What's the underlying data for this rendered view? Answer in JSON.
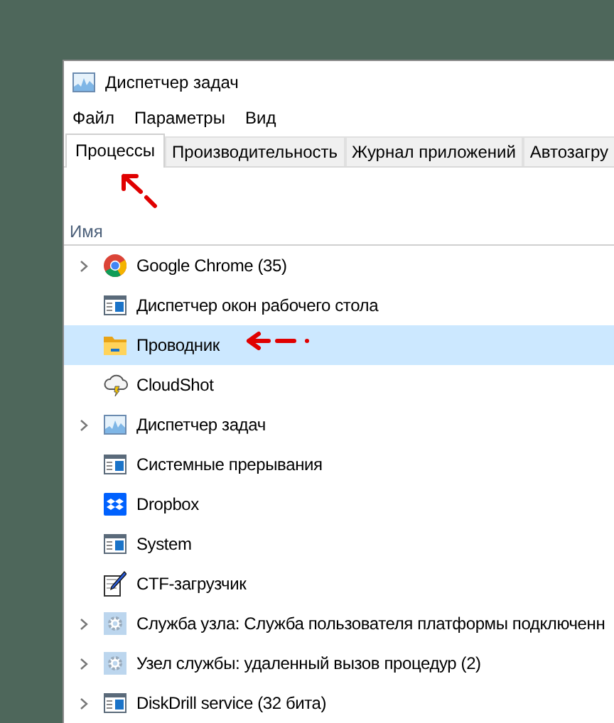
{
  "window": {
    "title": "Диспетчер задач"
  },
  "menu": [
    "Файл",
    "Параметры",
    "Вид"
  ],
  "tabs": [
    {
      "label": "Процессы",
      "selected": true
    },
    {
      "label": "Производительность",
      "selected": false
    },
    {
      "label": "Журнал приложений",
      "selected": false
    },
    {
      "label": "Автозагру",
      "selected": false
    }
  ],
  "table": {
    "columns": [
      "Имя"
    ],
    "rows": [
      {
        "name": "Google Chrome (35)",
        "kind": "chrome",
        "expandable": true,
        "selected": false
      },
      {
        "name": "Диспетчер окон рабочего стола",
        "kind": "window",
        "expandable": false,
        "selected": false
      },
      {
        "name": "Проводник",
        "kind": "folder",
        "expandable": false,
        "selected": true
      },
      {
        "name": "CloudShot",
        "kind": "cloud",
        "expandable": false,
        "selected": false
      },
      {
        "name": "Диспетчер задач",
        "kind": "chart",
        "expandable": true,
        "selected": false
      },
      {
        "name": "Системные прерывания",
        "kind": "window",
        "expandable": false,
        "selected": false
      },
      {
        "name": "Dropbox",
        "kind": "dropbox",
        "expandable": false,
        "selected": false
      },
      {
        "name": "System",
        "kind": "window",
        "expandable": false,
        "selected": false
      },
      {
        "name": "CTF-загрузчик",
        "kind": "pen",
        "expandable": false,
        "selected": false
      },
      {
        "name": "Служба узла: Служба пользователя платформы подключенн",
        "kind": "gear",
        "expandable": true,
        "selected": false
      },
      {
        "name": "Узел службы: удаленный вызов процедур (2)",
        "kind": "gear",
        "expandable": true,
        "selected": false
      },
      {
        "name": "DiskDrill service (32 бита)",
        "kind": "window",
        "expandable": true,
        "selected": false
      }
    ]
  }
}
